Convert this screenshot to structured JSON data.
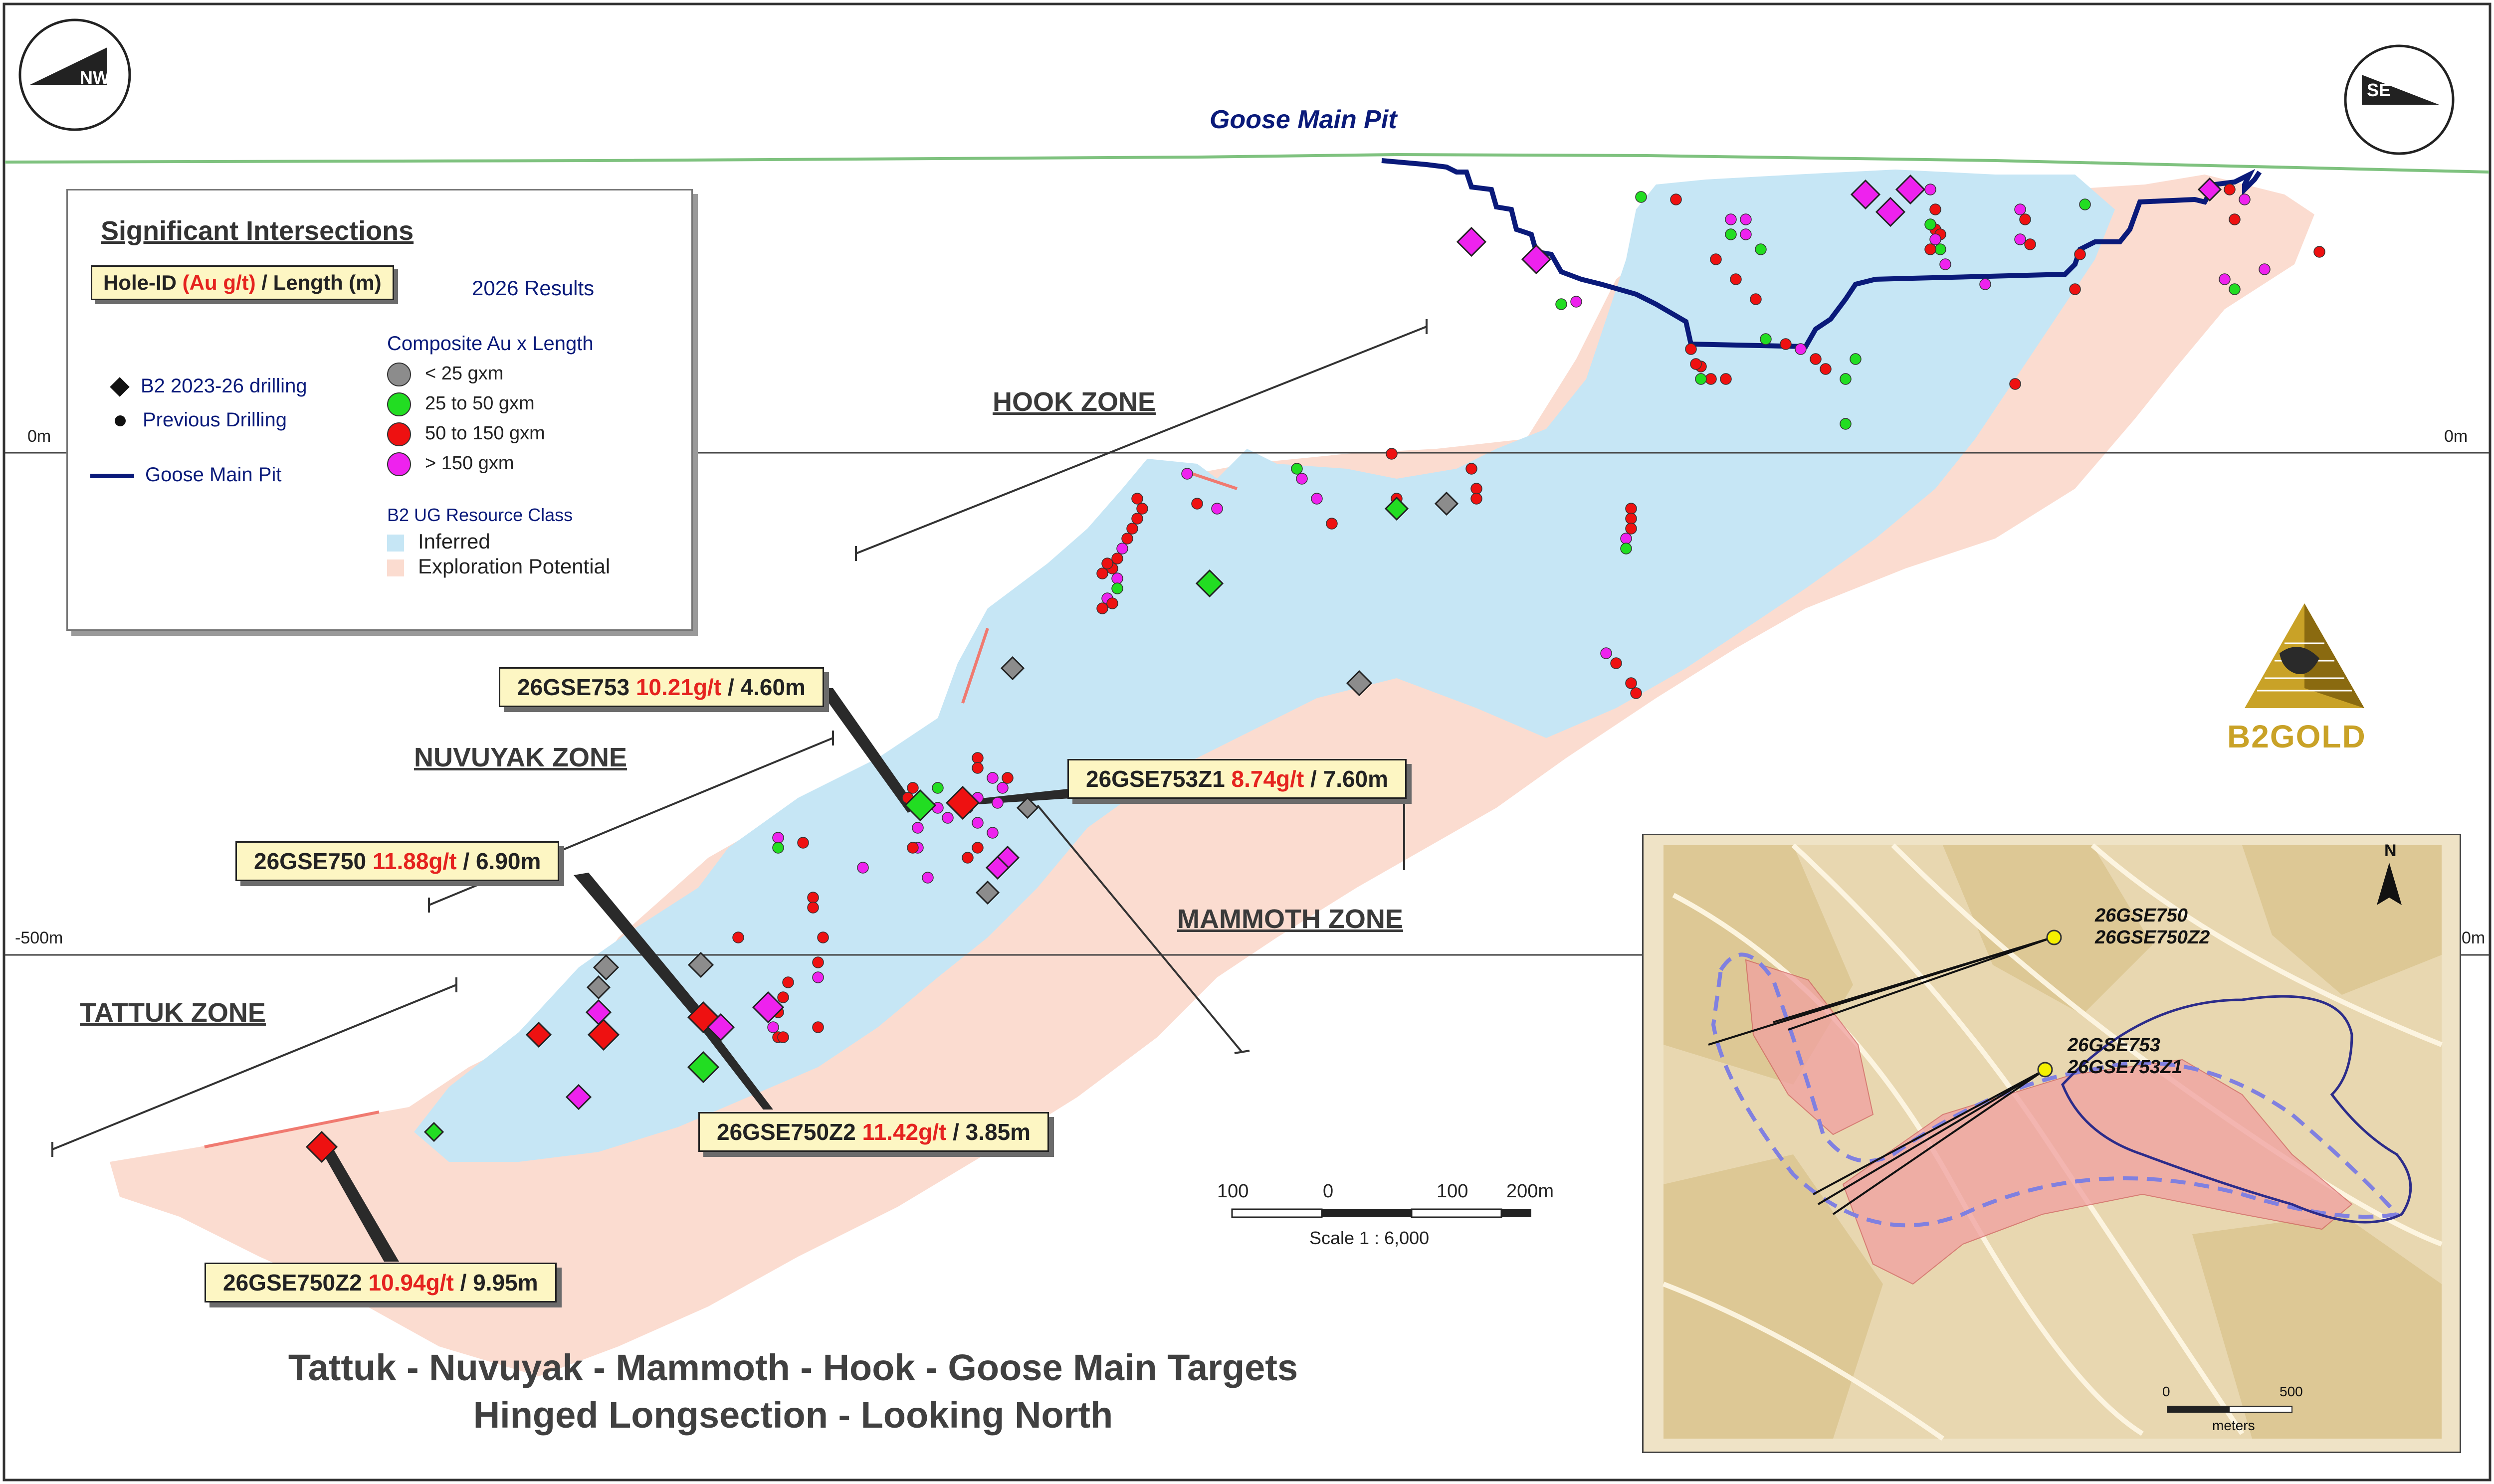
{
  "pit_label": "Goose Main Pit",
  "compass_left": "NW",
  "compass_right": "SE",
  "depth_labels": {
    "surface_left": "0m",
    "surface_right": "0m",
    "deep_left": "-500m",
    "deep_right": "0m"
  },
  "zones": {
    "hook": "HOOK ZONE",
    "nuvuyak": "NUVUYAK ZONE",
    "mammoth": "MAMMOTH  ZONE",
    "tattuk": "TATTUK ZONE"
  },
  "legend": {
    "title": "Significant Intersections",
    "format_hole": "Hole-ID",
    "format_grade": "(Au g/t)",
    "format_sep": "/ Length (m)",
    "results_year": "2026 Results",
    "composite_title": "Composite Au x Length",
    "composite_items": [
      {
        "label": "< 25 gxm",
        "color": "#8c8c8c"
      },
      {
        "label": "25 to 50 gxm",
        "color": "#22dd22"
      },
      {
        "label": "50 to 150 gxm",
        "color": "#ee1111"
      },
      {
        "label": "> 150 gxm",
        "color": "#ee22ee"
      }
    ],
    "symbol_b2": "B2 2023-26 drilling",
    "symbol_prev": "Previous Drilling",
    "symbol_pit": "Goose Main Pit",
    "resource_title": "B2 UG Resource Class",
    "inferred": "Inferred",
    "exploration": "Exploration Potential",
    "color_inferred": "#c6e6f5",
    "color_exploration": "#fbdcd0",
    "color_pit": "#0a1a7a"
  },
  "callouts": [
    {
      "id": "26GSE753",
      "grade": "10.21g/t",
      "length": "/ 4.60m"
    },
    {
      "id": "26GSE753Z1",
      "grade": "8.74g/t",
      "length": "/ 7.60m"
    },
    {
      "id": "26GSE750",
      "grade": "11.88g/t",
      "length": "/ 6.90m"
    },
    {
      "id": "26GSE750Z2",
      "grade": "11.42g/t",
      "length": "/ 3.85m"
    },
    {
      "id": "26GSE750Z2",
      "grade": "10.94g/t",
      "length": "/ 9.95m"
    }
  ],
  "scale": {
    "ticks": [
      "100",
      "0",
      "100",
      "200m"
    ],
    "text": "Scale 1 : 6,000"
  },
  "title_line1": "Tattuk - Nuvuyak - Mammoth - Hook - Goose Main Targets",
  "title_line2": "Hinged Longsection - Looking North",
  "logo": "B2GOLD",
  "inset": {
    "north": "N",
    "label_a1": "26GSE750",
    "label_a2": "26GSE750Z2",
    "label_b1": "26GSE753",
    "label_b2": "26GSE753Z1",
    "scale_0": "0",
    "scale_500": "500",
    "scale_unit": "meters"
  }
}
